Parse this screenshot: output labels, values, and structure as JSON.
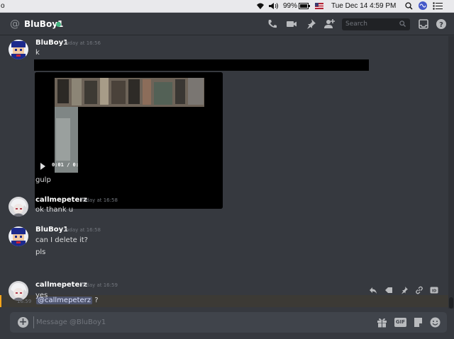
{
  "menubar": {
    "apple_left": "o",
    "battery": "99%",
    "flag": "us-flag-icon",
    "datetime": "Tue Dec 14  4:59 PM"
  },
  "header": {
    "dm_name": "BluBoy1",
    "search_placeholder": "Search"
  },
  "messages": [
    {
      "author": "BluBoy1",
      "timestamp": "Today at 16:56",
      "lines": [
        "k"
      ]
    },
    {
      "video_time": "0:01 / 0:",
      "after": "gulp"
    },
    {
      "author": "callmepeterz",
      "timestamp": "Today at 16:58",
      "lines": [
        "ok thank u"
      ]
    },
    {
      "author": "BluBoy1",
      "timestamp": "Today at 16:58",
      "lines": [
        "can I delete it?",
        "pls"
      ]
    },
    {
      "compact_time": "16:59",
      "mention": "@callmepeterz",
      "rest": " ?"
    },
    {
      "author": "callmepeterz",
      "timestamp": "Today at 16:59",
      "lines": [
        "yes"
      ]
    }
  ],
  "composer": {
    "placeholder": "Message @BluBoy1",
    "gif_label": "GIF"
  },
  "colors": {
    "background": "#36393f",
    "online": "#43b581",
    "mention_highlight": "#faa61a"
  }
}
